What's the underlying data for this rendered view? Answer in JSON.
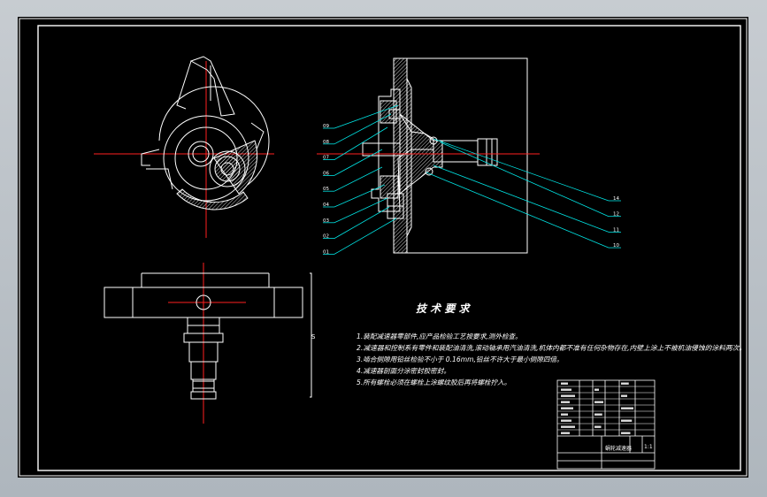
{
  "colors": {
    "background": "#000000",
    "line": "#ffffff",
    "centerline": "#ff2020",
    "leader": "#00e5e5",
    "hatch": "#ffffff",
    "frame": "#ffffff"
  },
  "balloons_left": [
    "09",
    "08",
    "07",
    "06",
    "05",
    "04",
    "03",
    "02",
    "01"
  ],
  "balloons_right": [
    "14",
    "12",
    "11",
    "10"
  ],
  "tech_requirements": {
    "title": "技 术 要 求",
    "items": [
      "1.装配减速器零部件,应产品检验工艺按要求,测外检查。",
      "2.减速器和控制系有零件和装配油清洗,滚动轴承用汽油清洗,机体内都不准有任何杂物存在,内壁上涂上不被机油侵蚀的涂料两次。",
      "3.啮合侧隙用铅丝检验不小于    0.16mm,铅丝不许大于最小侧隙四倍。",
      "4.减速器剖面分涂密封胶密封。",
      "5.所有螺栓必须在螺栓上涂螺纹胶后再将螺栓拧入。"
    ]
  },
  "side_mark": "S",
  "title_block": {
    "drawing_title": "蜗轮减速器",
    "scale": "1:1"
  }
}
